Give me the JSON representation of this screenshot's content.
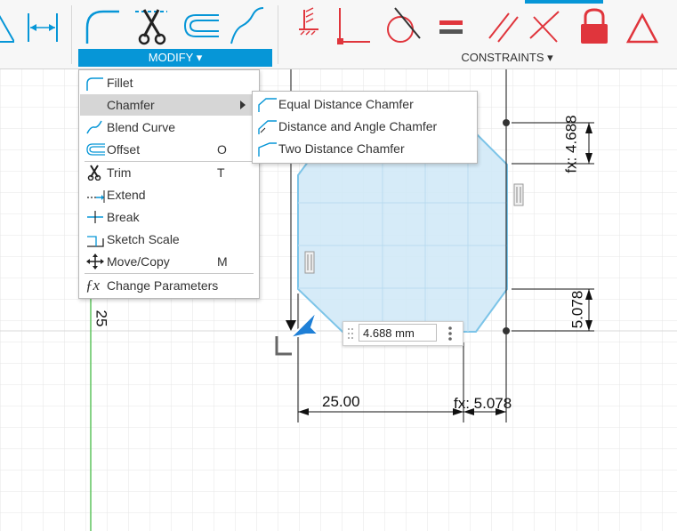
{
  "toolbar": {
    "modify_label": "MODIFY ▾",
    "constraints_label": "CONSTRAINTS ▾",
    "modify_tools": [
      "fillet-icon",
      "trim-icon",
      "offset-icon",
      "blend-curve-icon"
    ],
    "constraint_tools": [
      "fix-icon",
      "coincident-icon",
      "tangent-icon",
      "equal-icon",
      "parallel-icon",
      "perpendicular-icon",
      "lock-icon",
      "triangle-icon"
    ]
  },
  "modify_menu": {
    "items": [
      {
        "label": "Fillet",
        "shortcut": "",
        "icon": "fillet-icon"
      },
      {
        "label": "Chamfer",
        "shortcut": "",
        "icon": "chamfer-icon",
        "submenu": true
      },
      {
        "label": "Blend Curve",
        "shortcut": "",
        "icon": "blend-curve-icon"
      },
      {
        "label": "Offset",
        "shortcut": "O",
        "icon": "offset-icon"
      },
      {
        "label": "Trim",
        "shortcut": "T",
        "icon": "trim-icon"
      },
      {
        "label": "Extend",
        "shortcut": "",
        "icon": "extend-icon"
      },
      {
        "label": "Break",
        "shortcut": "",
        "icon": "break-icon"
      },
      {
        "label": "Sketch Scale",
        "shortcut": "",
        "icon": "sketch-scale-icon"
      },
      {
        "label": "Move/Copy",
        "shortcut": "M",
        "icon": "move-icon"
      },
      {
        "label": "Change Parameters",
        "shortcut": "",
        "icon": "fx-icon"
      }
    ]
  },
  "chamfer_submenu": {
    "items": [
      {
        "label": "Equal Distance Chamfer",
        "icon": "equal-distance-chamfer-icon"
      },
      {
        "label": "Distance and Angle Chamfer",
        "icon": "distance-angle-chamfer-icon"
      },
      {
        "label": "Two Distance Chamfer",
        "icon": "two-distance-chamfer-icon"
      }
    ]
  },
  "sketch": {
    "dim_input_value": "4.688 mm",
    "dim_bottom_width": "25.00",
    "dim_bottom_right": "fx: 5.078",
    "dim_right_top": "fx: 4.688",
    "dim_right_bottom": "5.078",
    "dim_left_vertical": "25",
    "colors": {
      "profile_fill": "#cfe8f7",
      "profile_edge": "#7cc4e8",
      "axis_green": "#5ec45e",
      "accent": "#0696d7",
      "constraint_red": "#e0353c"
    }
  }
}
